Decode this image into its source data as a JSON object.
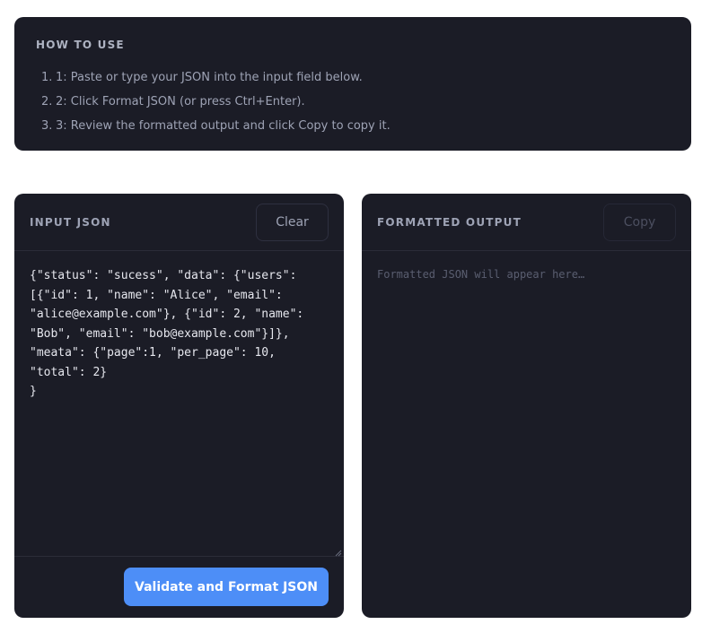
{
  "howto": {
    "title": "HOW TO USE",
    "steps": [
      {
        "num": "1.",
        "text": "1: Paste or type your JSON into the input field below."
      },
      {
        "num": "2.",
        "text": "2: Click Format JSON (or press Ctrl+Enter)."
      },
      {
        "num": "3.",
        "text": "3: Review the formatted output and click Copy to copy it."
      }
    ]
  },
  "input_panel": {
    "title": "INPUT JSON",
    "clear_label": "Clear",
    "value": "{\"status\": \"sucess\", \"data\": {\"users\": [{\"id\": 1, \"name\": \"Alice\", \"email\": \"alice@example.com\"}, {\"id\": 2, \"name\": \"Bob\", \"email\": \"bob@example.com\"}]}, \"meata\": {\"page\":1, \"per_page\": 10, \"total\": 2}\n}",
    "validate_label": "Validate and Format JSON"
  },
  "output_panel": {
    "title": "FORMATTED OUTPUT",
    "copy_label": "Copy",
    "placeholder": "Formatted JSON will appear here…"
  },
  "colors": {
    "card_bg": "#1b1c26",
    "accent": "#4d8ef7"
  }
}
